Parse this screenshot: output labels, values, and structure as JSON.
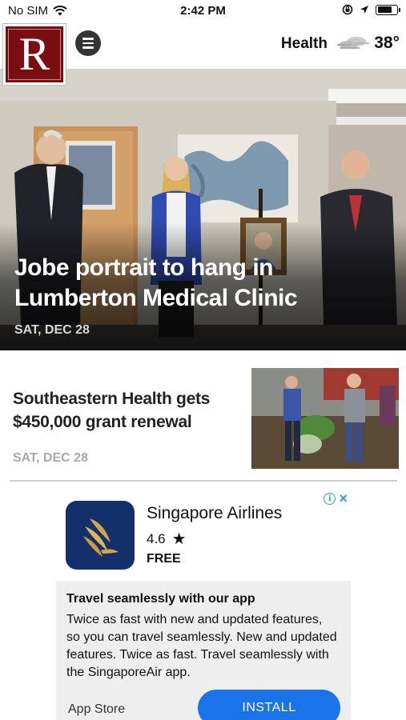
{
  "status_bar": {
    "carrier": "No SIM",
    "time": "2:42 PM",
    "icons": [
      "wifi-icon",
      "rotation-lock-icon",
      "location-arrow-icon",
      "battery-icon"
    ]
  },
  "header": {
    "logo_letter": "R",
    "menu_icon": "menu-icon",
    "section": "Health",
    "weather_icon": "cloudy-icon",
    "temperature": "38°"
  },
  "hero": {
    "title": "Jobe portrait to hang in Lumberton Medical Clinic",
    "date": "SAT, DEC 28"
  },
  "stories": [
    {
      "title": "Southeastern Health gets $450,000 grant renewal",
      "date": "SAT, DEC 28"
    }
  ],
  "ad": {
    "app_name": "Singapore Airlines",
    "rating": "4.6",
    "rating_icon": "star-icon",
    "price": "FREE",
    "headline": "Travel seamlessly with our app",
    "body": "Twice as fast with new and updated features, so you can travel seamlessly. New and updated features. Twice as fast. Travel seamlessly with the SingaporeAir app.",
    "store": "App Store",
    "cta": "INSTALL",
    "choices_icons": [
      "ad-info-icon",
      "ad-close-icon"
    ],
    "colors": {
      "cta": "#1a73e8",
      "choices": "#27a0e0",
      "icon_bg": "#14306b",
      "icon_bird": "#d4a64a"
    }
  },
  "colors": {
    "logo_bg": "#7a0d12",
    "date_grey": "#a8a8a8"
  }
}
